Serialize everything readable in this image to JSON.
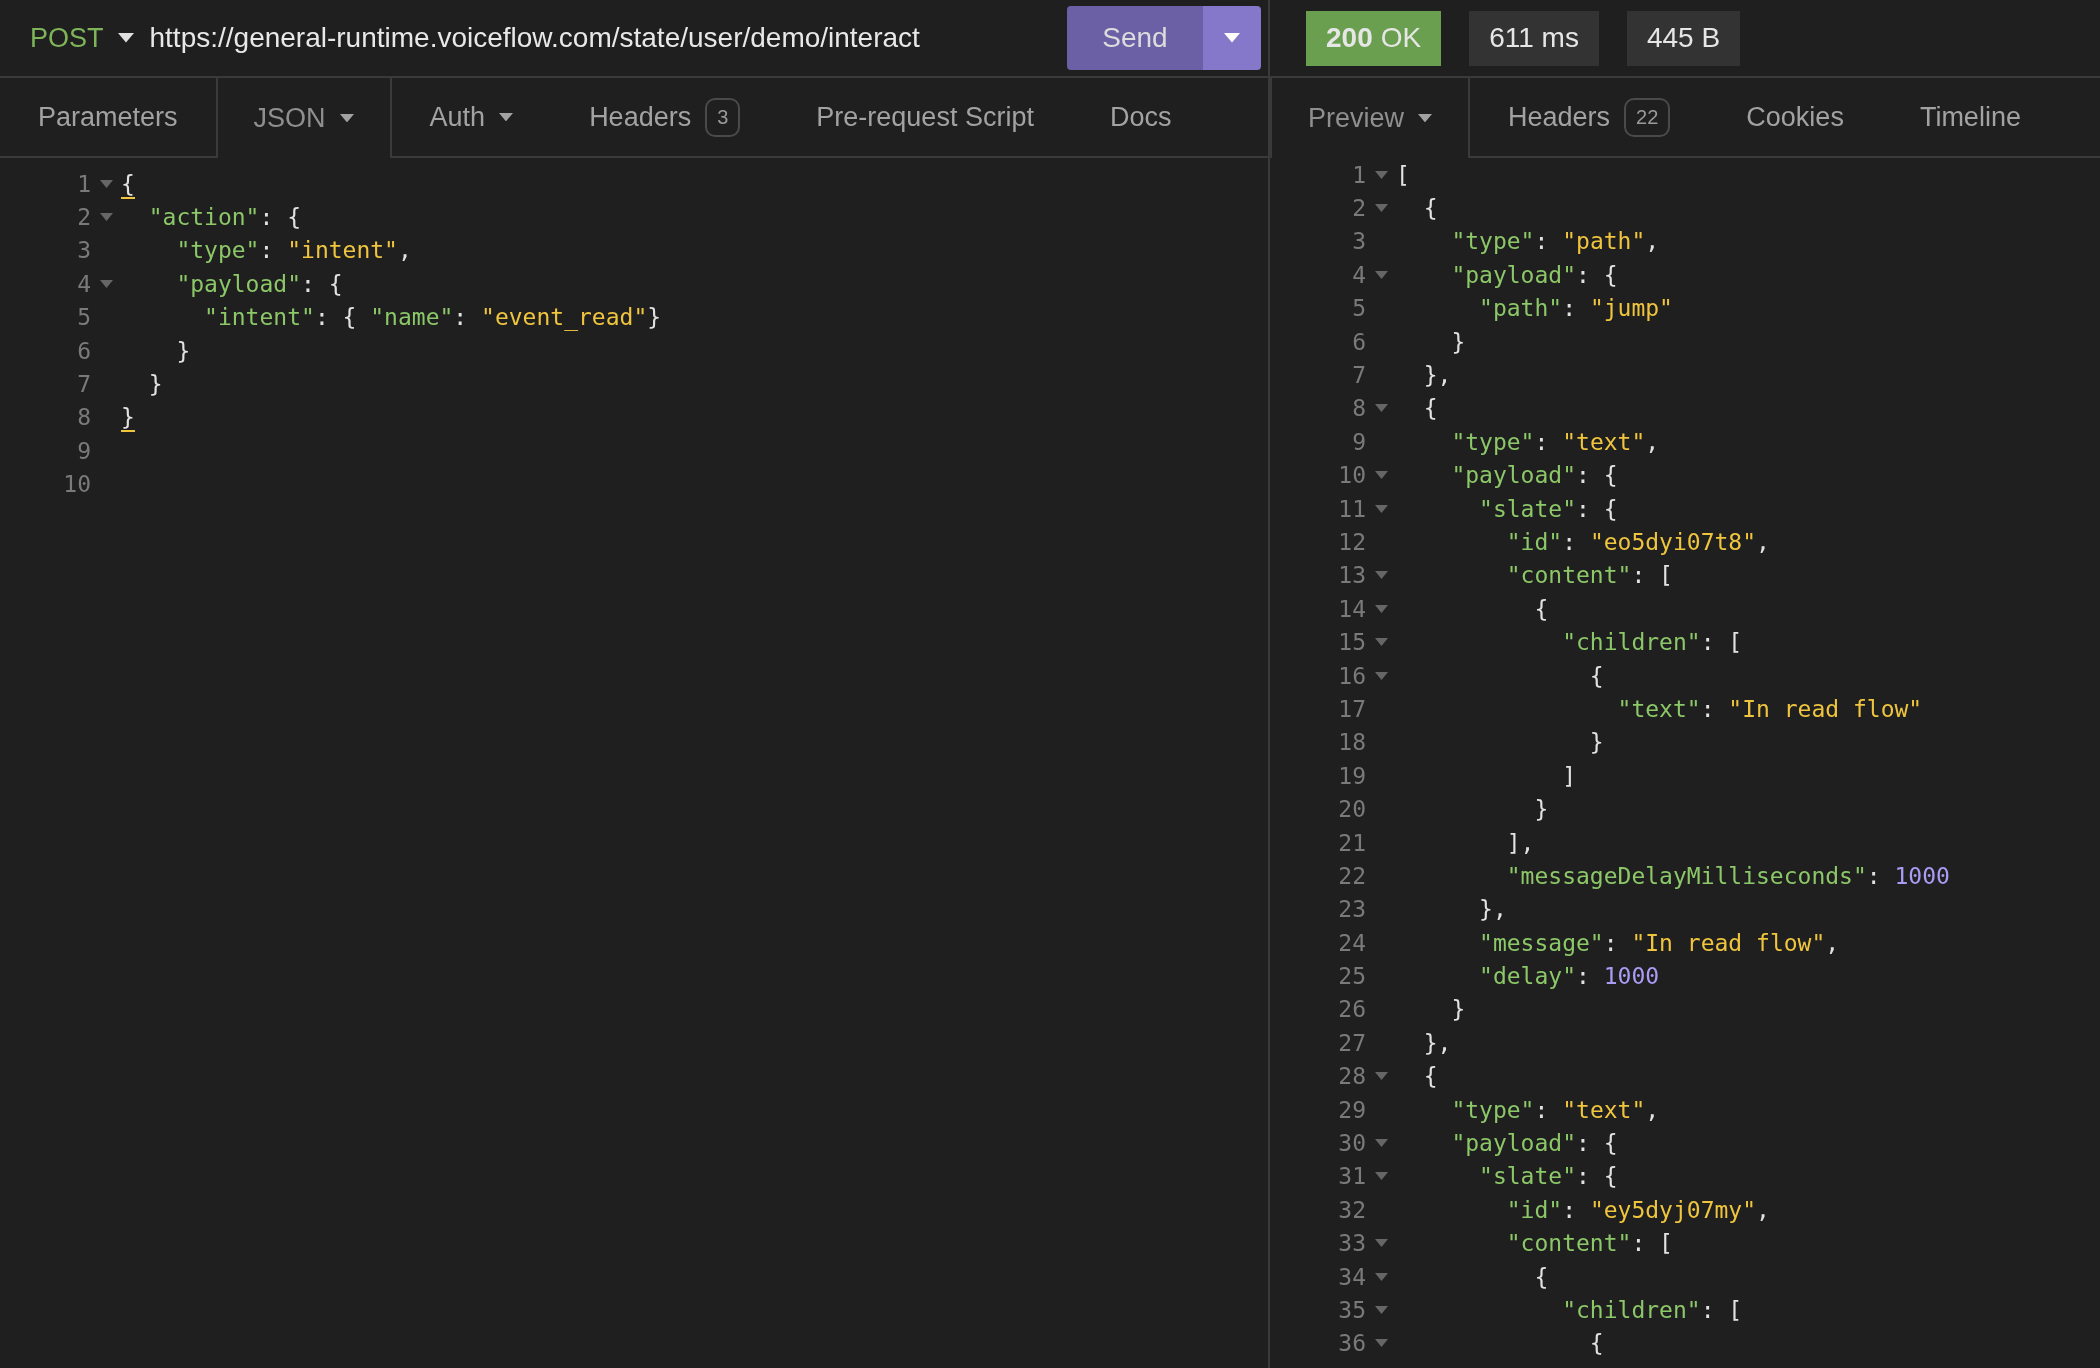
{
  "request_bar": {
    "method": "POST",
    "url": "https://general-runtime.voiceflow.com/state/user/demo/interact",
    "send_label": "Send"
  },
  "response_stats": {
    "status_code": "200",
    "status_text": "OK",
    "time": "611 ms",
    "size": "445 B"
  },
  "request_tabs": [
    {
      "label": "Parameters",
      "selected": false
    },
    {
      "label": "JSON",
      "selected": true,
      "dropdown": true
    },
    {
      "label": "Auth",
      "selected": false,
      "dropdown": true
    },
    {
      "label": "Headers",
      "selected": false,
      "badge": "3"
    },
    {
      "label": "Pre-request Script",
      "selected": false
    },
    {
      "label": "Docs",
      "selected": false
    }
  ],
  "request_body": {
    "lines": [
      {
        "number": "1",
        "foldable": true,
        "tokens": [
          {
            "kind": "punct",
            "text": "{",
            "matched": true
          }
        ]
      },
      {
        "number": "2",
        "foldable": true,
        "tokens": [
          {
            "kind": "key",
            "text": "  \"action\""
          },
          {
            "kind": "punct",
            "text": ": {"
          }
        ]
      },
      {
        "number": "3",
        "foldable": false,
        "tokens": [
          {
            "kind": "key",
            "text": "    \"type\""
          },
          {
            "kind": "punct",
            "text": ": "
          },
          {
            "kind": "string",
            "text": "\"intent\""
          },
          {
            "kind": "punct",
            "text": ","
          }
        ]
      },
      {
        "number": "4",
        "foldable": true,
        "tokens": [
          {
            "kind": "key",
            "text": "    \"payload\""
          },
          {
            "kind": "punct",
            "text": ": {"
          }
        ]
      },
      {
        "number": "5",
        "foldable": false,
        "tokens": [
          {
            "kind": "key",
            "text": "      \"intent\""
          },
          {
            "kind": "punct",
            "text": ": { "
          },
          {
            "kind": "key",
            "text": "\"name\""
          },
          {
            "kind": "punct",
            "text": ": "
          },
          {
            "kind": "string",
            "text": "\"event_read\""
          },
          {
            "kind": "punct",
            "text": "}"
          }
        ]
      },
      {
        "number": "6",
        "foldable": false,
        "tokens": [
          {
            "kind": "punct",
            "text": "    }"
          }
        ]
      },
      {
        "number": "7",
        "foldable": false,
        "tokens": [
          {
            "kind": "punct",
            "text": "  }"
          }
        ]
      },
      {
        "number": "8",
        "foldable": false,
        "tokens": [
          {
            "kind": "punct",
            "text": "}",
            "matched": true
          }
        ]
      },
      {
        "number": "9",
        "foldable": false
      },
      {
        "number": "10",
        "foldable": false
      }
    ]
  },
  "response_tabs": [
    {
      "label": "Preview",
      "selected": true,
      "dropdown": true
    },
    {
      "label": "Headers",
      "selected": false,
      "badge": "22"
    },
    {
      "label": "Cookies",
      "selected": false
    },
    {
      "label": "Timeline",
      "selected": false
    }
  ],
  "response_body": {
    "lines": [
      {
        "number": "1",
        "foldable": true,
        "tokens": [
          {
            "kind": "punct",
            "text": "["
          }
        ]
      },
      {
        "number": "2",
        "foldable": true,
        "tokens": [
          {
            "kind": "punct",
            "text": "  {"
          }
        ]
      },
      {
        "number": "3",
        "foldable": false,
        "tokens": [
          {
            "kind": "key",
            "text": "    \"type\""
          },
          {
            "kind": "punct",
            "text": ": "
          },
          {
            "kind": "string",
            "text": "\"path\""
          },
          {
            "kind": "punct",
            "text": ","
          }
        ]
      },
      {
        "number": "4",
        "foldable": true,
        "tokens": [
          {
            "kind": "key",
            "text": "    \"payload\""
          },
          {
            "kind": "punct",
            "text": ": {"
          }
        ]
      },
      {
        "number": "5",
        "foldable": false,
        "tokens": [
          {
            "kind": "key",
            "text": "      \"path\""
          },
          {
            "kind": "punct",
            "text": ": "
          },
          {
            "kind": "string",
            "text": "\"jump\""
          }
        ]
      },
      {
        "number": "6",
        "foldable": false,
        "tokens": [
          {
            "kind": "punct",
            "text": "    }"
          }
        ]
      },
      {
        "number": "7",
        "foldable": false,
        "tokens": [
          {
            "kind": "punct",
            "text": "  },"
          }
        ]
      },
      {
        "number": "8",
        "foldable": true,
        "tokens": [
          {
            "kind": "punct",
            "text": "  {"
          }
        ]
      },
      {
        "number": "9",
        "foldable": false,
        "tokens": [
          {
            "kind": "key",
            "text": "    \"type\""
          },
          {
            "kind": "punct",
            "text": ": "
          },
          {
            "kind": "string",
            "text": "\"text\""
          },
          {
            "kind": "punct",
            "text": ","
          }
        ]
      },
      {
        "number": "10",
        "foldable": true,
        "tokens": [
          {
            "kind": "key",
            "text": "    \"payload\""
          },
          {
            "kind": "punct",
            "text": ": {"
          }
        ]
      },
      {
        "number": "11",
        "foldable": true,
        "tokens": [
          {
            "kind": "key",
            "text": "      \"slate\""
          },
          {
            "kind": "punct",
            "text": ": {"
          }
        ]
      },
      {
        "number": "12",
        "foldable": false,
        "tokens": [
          {
            "kind": "key",
            "text": "        \"id\""
          },
          {
            "kind": "punct",
            "text": ": "
          },
          {
            "kind": "string",
            "text": "\"eo5dyi07t8\""
          },
          {
            "kind": "punct",
            "text": ","
          }
        ]
      },
      {
        "number": "13",
        "foldable": true,
        "tokens": [
          {
            "kind": "key",
            "text": "        \"content\""
          },
          {
            "kind": "punct",
            "text": ": ["
          }
        ]
      },
      {
        "number": "14",
        "foldable": true,
        "tokens": [
          {
            "kind": "punct",
            "text": "          {"
          }
        ]
      },
      {
        "number": "15",
        "foldable": true,
        "tokens": [
          {
            "kind": "key",
            "text": "            \"children\""
          },
          {
            "kind": "punct",
            "text": ": ["
          }
        ]
      },
      {
        "number": "16",
        "foldable": true,
        "tokens": [
          {
            "kind": "punct",
            "text": "              {"
          }
        ]
      },
      {
        "number": "17",
        "foldable": false,
        "tokens": [
          {
            "kind": "key",
            "text": "                \"text\""
          },
          {
            "kind": "punct",
            "text": ": "
          },
          {
            "kind": "string",
            "text": "\"In read flow\""
          }
        ]
      },
      {
        "number": "18",
        "foldable": false,
        "tokens": [
          {
            "kind": "punct",
            "text": "              }"
          }
        ]
      },
      {
        "number": "19",
        "foldable": false,
        "tokens": [
          {
            "kind": "punct",
            "text": "            ]"
          }
        ]
      },
      {
        "number": "20",
        "foldable": false,
        "tokens": [
          {
            "kind": "punct",
            "text": "          }"
          }
        ]
      },
      {
        "number": "21",
        "foldable": false,
        "tokens": [
          {
            "kind": "punct",
            "text": "        ],"
          }
        ]
      },
      {
        "number": "22",
        "foldable": false,
        "tokens": [
          {
            "kind": "key",
            "text": "        \"messageDelayMilliseconds\""
          },
          {
            "kind": "punct",
            "text": ": "
          },
          {
            "kind": "number",
            "text": "1000"
          }
        ]
      },
      {
        "number": "23",
        "foldable": false,
        "tokens": [
          {
            "kind": "punct",
            "text": "      },"
          }
        ]
      },
      {
        "number": "24",
        "foldable": false,
        "tokens": [
          {
            "kind": "key",
            "text": "      \"message\""
          },
          {
            "kind": "punct",
            "text": ": "
          },
          {
            "kind": "string",
            "text": "\"In read flow\""
          },
          {
            "kind": "punct",
            "text": ","
          }
        ]
      },
      {
        "number": "25",
        "foldable": false,
        "tokens": [
          {
            "kind": "key",
            "text": "      \"delay\""
          },
          {
            "kind": "punct",
            "text": ": "
          },
          {
            "kind": "number",
            "text": "1000"
          }
        ]
      },
      {
        "number": "26",
        "foldable": false,
        "tokens": [
          {
            "kind": "punct",
            "text": "    }"
          }
        ]
      },
      {
        "number": "27",
        "foldable": false,
        "tokens": [
          {
            "kind": "punct",
            "text": "  },"
          }
        ]
      },
      {
        "number": "28",
        "foldable": true,
        "tokens": [
          {
            "kind": "punct",
            "text": "  {"
          }
        ]
      },
      {
        "number": "29",
        "foldable": false,
        "tokens": [
          {
            "kind": "key",
            "text": "    \"type\""
          },
          {
            "kind": "punct",
            "text": ": "
          },
          {
            "kind": "string",
            "text": "\"text\""
          },
          {
            "kind": "punct",
            "text": ","
          }
        ]
      },
      {
        "number": "30",
        "foldable": true,
        "tokens": [
          {
            "kind": "key",
            "text": "    \"payload\""
          },
          {
            "kind": "punct",
            "text": ": {"
          }
        ]
      },
      {
        "number": "31",
        "foldable": true,
        "tokens": [
          {
            "kind": "key",
            "text": "      \"slate\""
          },
          {
            "kind": "punct",
            "text": ": {"
          }
        ]
      },
      {
        "number": "32",
        "foldable": false,
        "tokens": [
          {
            "kind": "key",
            "text": "        \"id\""
          },
          {
            "kind": "punct",
            "text": ": "
          },
          {
            "kind": "string",
            "text": "\"ey5dyj07my\""
          },
          {
            "kind": "punct",
            "text": ","
          }
        ]
      },
      {
        "number": "33",
        "foldable": true,
        "tokens": [
          {
            "kind": "key",
            "text": "        \"content\""
          },
          {
            "kind": "punct",
            "text": ": ["
          }
        ]
      },
      {
        "number": "34",
        "foldable": true,
        "tokens": [
          {
            "kind": "punct",
            "text": "          {"
          }
        ]
      },
      {
        "number": "35",
        "foldable": true,
        "tokens": [
          {
            "kind": "key",
            "text": "            \"children\""
          },
          {
            "kind": "punct",
            "text": ": ["
          }
        ]
      },
      {
        "number": "36",
        "foldable": true,
        "tokens": [
          {
            "kind": "punct",
            "text": "              {"
          }
        ]
      }
    ]
  }
}
